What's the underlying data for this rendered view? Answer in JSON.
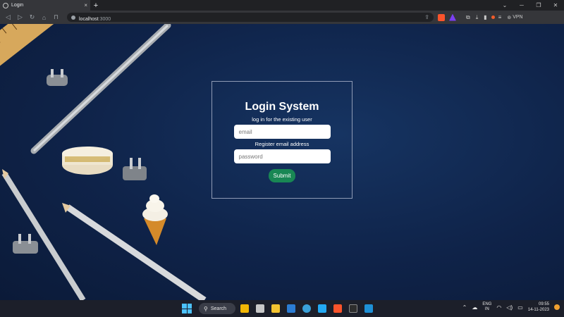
{
  "browser": {
    "tab_title": "Login",
    "tab_close": "×",
    "new_tab": "+",
    "url_host": "localhost",
    "url_port": ":3000",
    "vpn_label": "VPN",
    "window_controls": [
      "⌄",
      "─",
      "❐",
      "✕"
    ]
  },
  "login": {
    "title": "Login System",
    "subtitle": "log in for the existing user",
    "email_placeholder": "email",
    "email_hint": "Register email address",
    "password_placeholder": "password",
    "submit_label": "Submit"
  },
  "taskbar": {
    "search_label": "Search",
    "lang_line1": "ENG",
    "lang_line2": "IN",
    "time": "09:55",
    "date": "14-11-2023",
    "apps": [
      {
        "name": "widgets",
        "color": "#f2b705"
      },
      {
        "name": "file-manager",
        "color": "#c8c8c8"
      },
      {
        "name": "explorer",
        "color": "#f4c430"
      },
      {
        "name": "store",
        "color": "#2b7cd3"
      },
      {
        "name": "edge",
        "color": "#3aa0d8"
      },
      {
        "name": "vscode",
        "color": "#23a9f2"
      },
      {
        "name": "brave",
        "color": "#fb542b"
      },
      {
        "name": "terminal",
        "color": "#2d2d2d"
      },
      {
        "name": "azure-data",
        "color": "#1e90d6"
      }
    ]
  },
  "colors": {
    "submit_button": "#198754",
    "page_background": "#0f2349",
    "taskbar": "#1c1f2a"
  }
}
